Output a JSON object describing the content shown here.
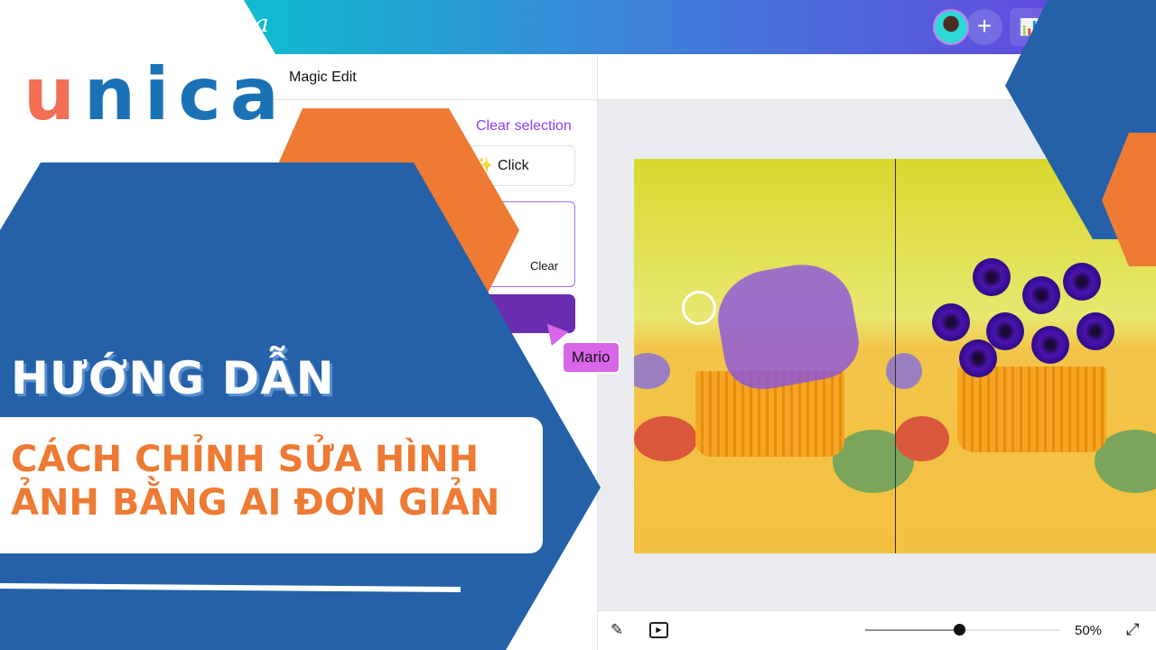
{
  "brand": {
    "logo_text": "unica",
    "app_partial": "a"
  },
  "topbar": {
    "add_label": "+",
    "analytics_icon": "bar-chart-icon"
  },
  "panel": {
    "title": "Magic Edit",
    "clear_selection": "Clear selection",
    "click_label": "Click",
    "clear_label": "Clear"
  },
  "collaborator": {
    "name": "Mario"
  },
  "bottombar": {
    "zoom": "50%",
    "zoom_level_percent": 50
  },
  "thumbnail": {
    "heading": "HƯỚNG DẪN",
    "subtitle_line1": "CÁCH CHỈNH SỬA HÌNH",
    "subtitle_line2": "ẢNH BẰNG AI ĐƠN GIẢN"
  },
  "colors": {
    "blue": "#2461a8",
    "orange": "#ee7a33",
    "purple": "#8b3dff",
    "button": "#6a2db0"
  }
}
